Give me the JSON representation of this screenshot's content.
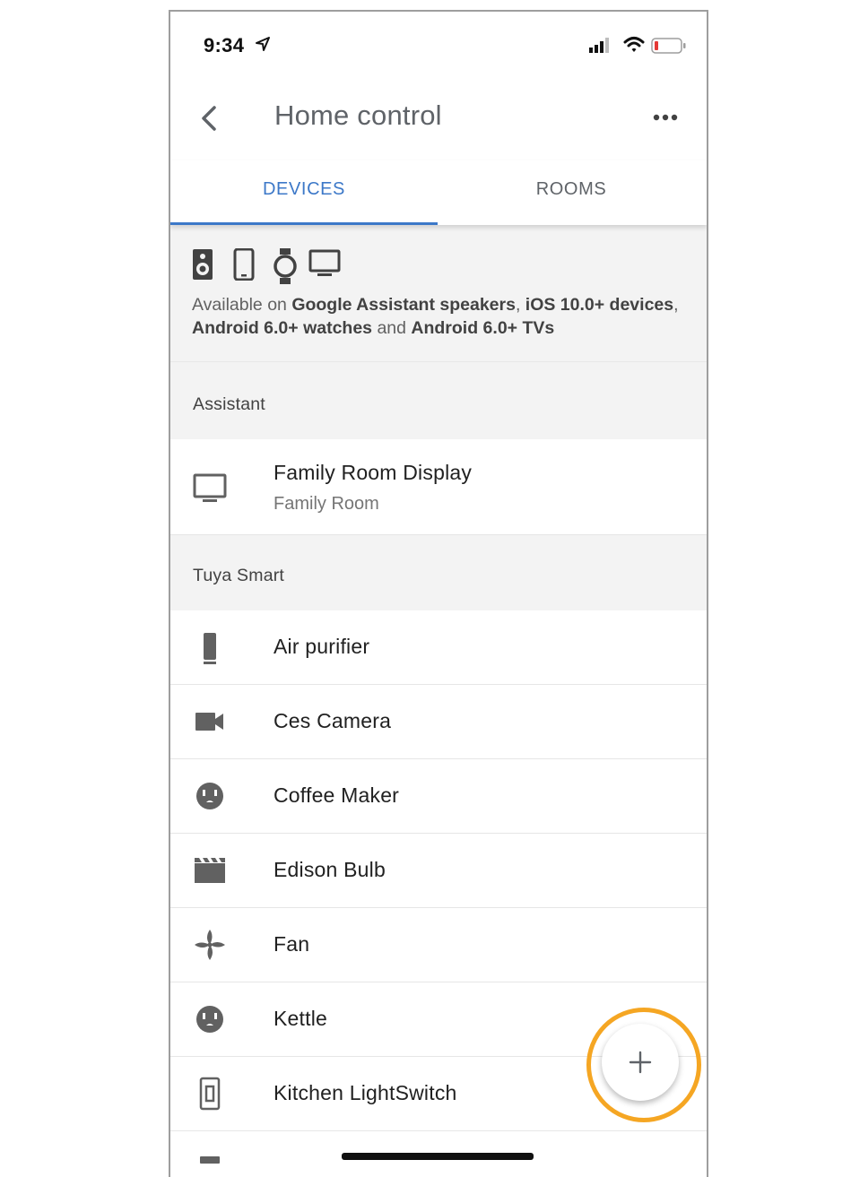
{
  "status_bar": {
    "time": "9:34"
  },
  "app_bar": {
    "title": "Home control"
  },
  "tabs": [
    {
      "label": "DEVICES",
      "selected": true
    },
    {
      "label": "ROOMS",
      "selected": false
    }
  ],
  "info": {
    "icons": [
      "speaker-icon",
      "phone-icon",
      "watch-icon",
      "tv-icon"
    ],
    "text_pre": "Available on ",
    "bold1": "Google Assistant speakers",
    "text_mid1": ", ",
    "bold2": "iOS 10.0+ devices",
    "text_mid2": ", ",
    "bold3": "Android 6.0+ watches",
    "text_mid3": " and ",
    "bold4": "Android 6.0+ TVs"
  },
  "sections": {
    "assistant": {
      "label": "Assistant",
      "devices": [
        {
          "name": "Family Room Display",
          "room": "Family Room",
          "icon": "tv-icon"
        }
      ]
    },
    "tuya": {
      "label": "Tuya Smart",
      "devices": [
        {
          "name": "Air purifier",
          "icon": "air-purifier-icon"
        },
        {
          "name": "Ces Camera",
          "icon": "camera-icon"
        },
        {
          "name": "Coffee Maker",
          "icon": "outlet-icon"
        },
        {
          "name": "Edison Bulb",
          "icon": "film-icon"
        },
        {
          "name": "Fan",
          "icon": "fan-icon"
        },
        {
          "name": "Kettle",
          "icon": "outlet-icon"
        },
        {
          "name": "Kitchen LightSwitch",
          "icon": "light-switch-icon"
        }
      ]
    }
  },
  "fab": {
    "icon": "plus-icon",
    "highlight_color": "#f5a623"
  },
  "colors": {
    "accent": "#3c78c8",
    "section_bg": "#f3f3f3",
    "icon_gray": "#616161"
  }
}
